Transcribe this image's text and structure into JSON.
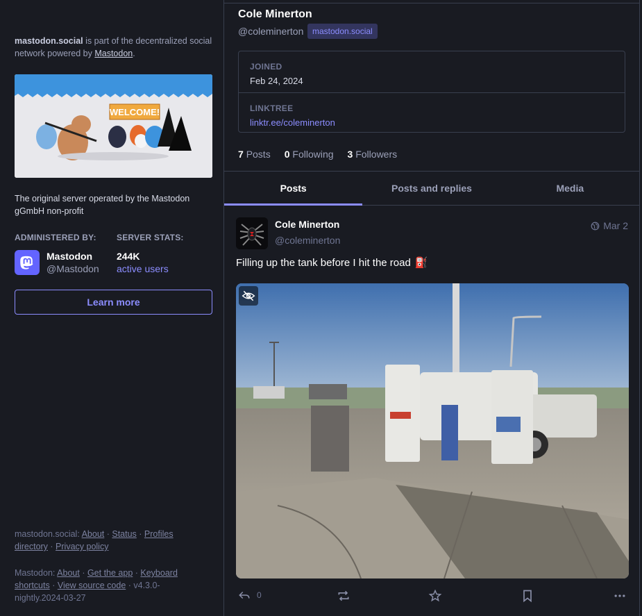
{
  "sidebar": {
    "intro_server": "mastodon.social",
    "intro_middle": " is part of the decentralized social network powered by ",
    "intro_link": "Mastodon",
    "intro_end": ".",
    "hero_sign": "WELCOME!",
    "server_description": "The original server operated by the Mastodon gGmbH non-profit",
    "administered_by_label": "ADMINISTERED BY:",
    "server_stats_label": "SERVER STATS:",
    "admin_name": "Mastodon",
    "admin_handle": "@Mastodon",
    "stat_value": "244K",
    "stat_label": "active users",
    "learn_more": "Learn more",
    "footer1": {
      "server": "mastodon.social",
      "sep": ": ",
      "about": "About",
      "status": "Status",
      "profiles": "Profiles directory",
      "privacy": "Privacy policy"
    },
    "footer2": {
      "name": "Mastodon",
      "about": "About",
      "get_app": "Get the app",
      "keyboard": "Keyboard shortcuts",
      "source": "View source code",
      "version": "v4.3.0-nightly.2024-03-27"
    }
  },
  "profile": {
    "display_name": "Cole Minerton",
    "handle": "@coleminerton",
    "domain_badge": "mastodon.social",
    "fields": [
      {
        "label": "JOINED",
        "value": "Feb 24, 2024"
      },
      {
        "label": "LINKTREE",
        "value": "linktr.ee/coleminerton"
      }
    ],
    "counts": {
      "posts_num": "7",
      "posts_label": "Posts",
      "following_num": "0",
      "following_label": "Following",
      "followers_num": "3",
      "followers_label": "Followers"
    },
    "tabs": [
      "Posts",
      "Posts and replies",
      "Media"
    ]
  },
  "status": {
    "name": "Cole Minerton",
    "handle": "@coleminerton",
    "time": "Mar 2",
    "text": "Filling up the tank before I hit the road",
    "emoji": "⛽",
    "reply_count": "0"
  },
  "icons": {
    "visibility": "globe-icon",
    "sensitive": "eye-slash-icon",
    "reply": "reply-icon",
    "boost": "boost-icon",
    "favourite": "star-icon",
    "bookmark": "bookmark-icon",
    "more": "more-icon"
  },
  "colors": {
    "background": "#191b22",
    "accent": "#8c8dff",
    "border": "#393f4f",
    "muted": "#9ba0b8",
    "brand": "#6364ff"
  }
}
